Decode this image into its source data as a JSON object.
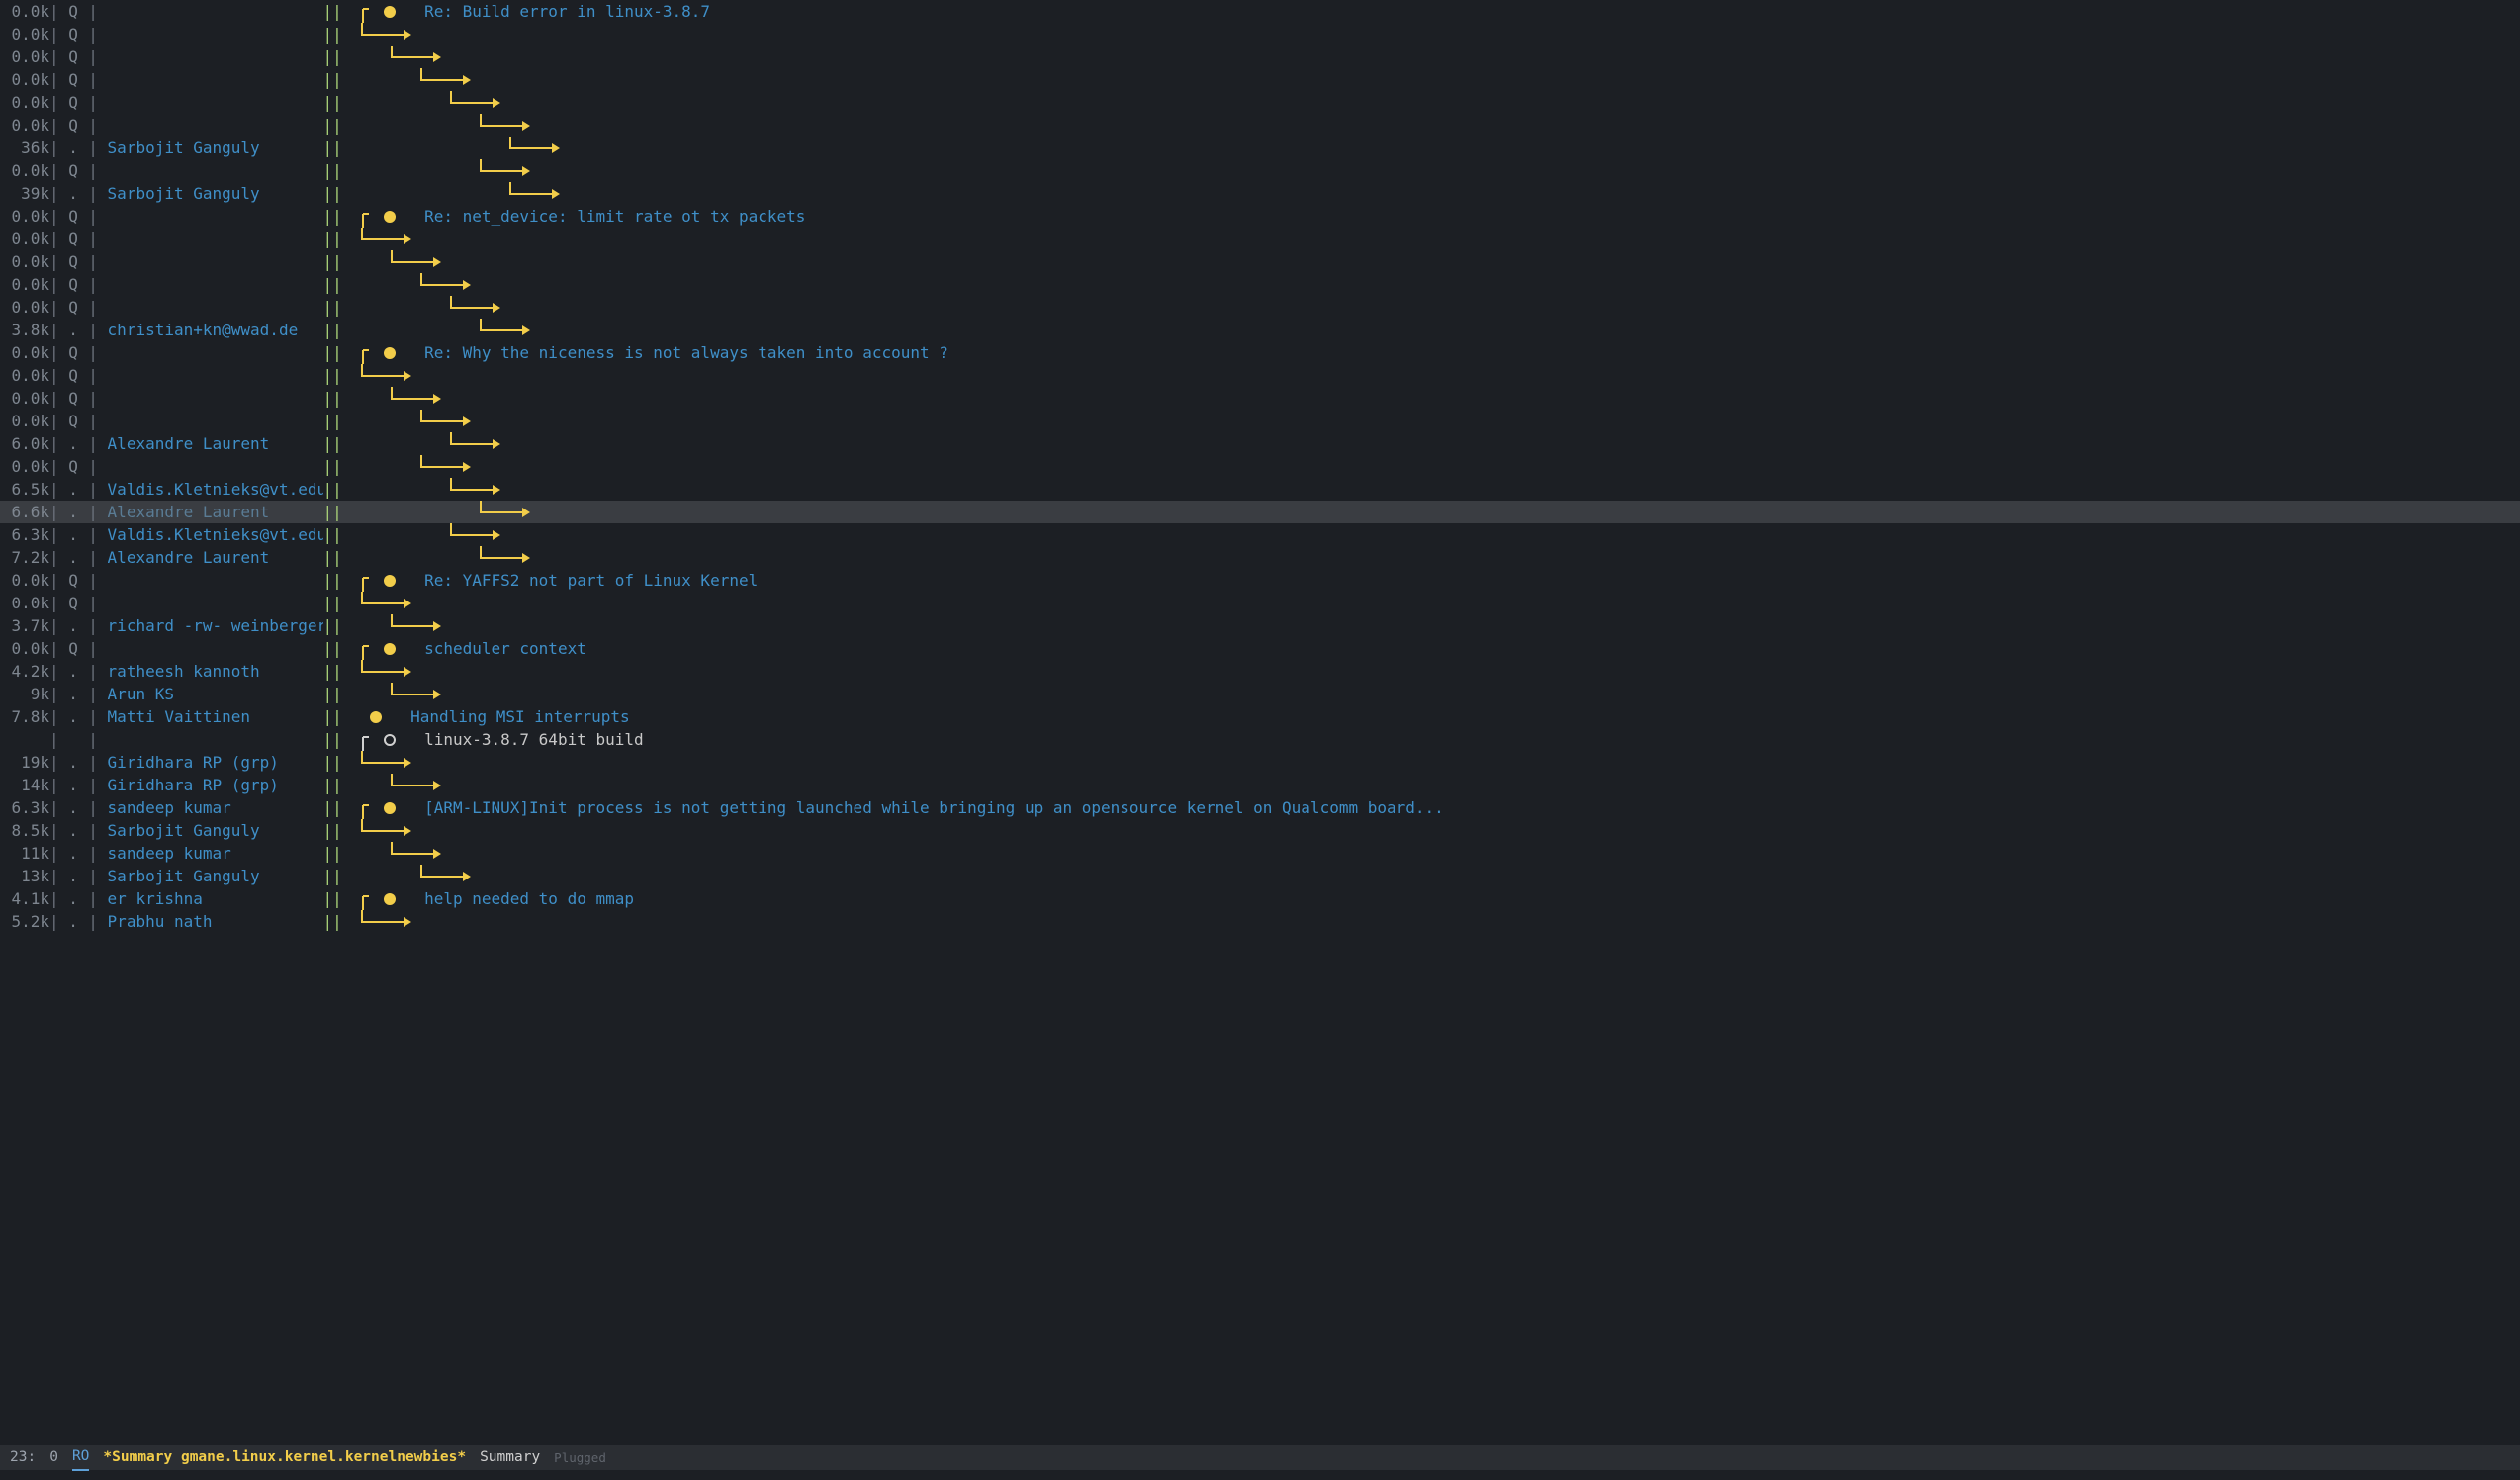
{
  "separator_major": "|",
  "double_bar": "||",
  "modeline": {
    "line": "23:",
    "col": "0",
    "readonly": "RO",
    "buffer": "*Summary gmane.linux.kernel.kernelnewbies*",
    "mode": "Summary",
    "status": "Plugged"
  },
  "rows": [
    {
      "size": "0.0k",
      "mark": "Q",
      "author": "",
      "depth": 0,
      "node": "root",
      "subject": "Re: Build error in linux-3.8.7",
      "highlight": false
    },
    {
      "size": "0.0k",
      "mark": "Q",
      "author": "",
      "depth": 0,
      "node": "child",
      "subject": "",
      "highlight": false
    },
    {
      "size": "0.0k",
      "mark": "Q",
      "author": "",
      "depth": 1,
      "node": "child",
      "subject": "",
      "highlight": false
    },
    {
      "size": "0.0k",
      "mark": "Q",
      "author": "",
      "depth": 2,
      "node": "child",
      "subject": "",
      "highlight": false
    },
    {
      "size": "0.0k",
      "mark": "Q",
      "author": "",
      "depth": 3,
      "node": "child",
      "subject": "",
      "highlight": false
    },
    {
      "size": "0.0k",
      "mark": "Q",
      "author": "",
      "depth": 4,
      "node": "child",
      "subject": "",
      "highlight": false
    },
    {
      "size": "36k",
      "mark": ".",
      "author": "Sarbojit Ganguly",
      "depth": 5,
      "node": "child",
      "subject": "",
      "highlight": false
    },
    {
      "size": "0.0k",
      "mark": "Q",
      "author": "",
      "depth": 4,
      "node": "child",
      "subject": "",
      "highlight": false
    },
    {
      "size": "39k",
      "mark": ".",
      "author": "Sarbojit Ganguly",
      "depth": 5,
      "node": "child",
      "subject": "",
      "highlight": false
    },
    {
      "size": "0.0k",
      "mark": "Q",
      "author": "",
      "depth": 0,
      "node": "root",
      "subject": "Re: net_device: limit rate ot tx packets",
      "highlight": false
    },
    {
      "size": "0.0k",
      "mark": "Q",
      "author": "",
      "depth": 0,
      "node": "child",
      "subject": "",
      "highlight": false
    },
    {
      "size": "0.0k",
      "mark": "Q",
      "author": "",
      "depth": 1,
      "node": "child",
      "subject": "",
      "highlight": false
    },
    {
      "size": "0.0k",
      "mark": "Q",
      "author": "",
      "depth": 2,
      "node": "child",
      "subject": "",
      "highlight": false
    },
    {
      "size": "0.0k",
      "mark": "Q",
      "author": "",
      "depth": 3,
      "node": "child",
      "subject": "",
      "highlight": false
    },
    {
      "size": "3.8k",
      "mark": ".",
      "author": "christian+kn@wwad.de",
      "depth": 4,
      "node": "child",
      "subject": "",
      "highlight": false
    },
    {
      "size": "0.0k",
      "mark": "Q",
      "author": "",
      "depth": 0,
      "node": "root",
      "subject": "Re: Why the niceness is not always taken into account ?",
      "highlight": false
    },
    {
      "size": "0.0k",
      "mark": "Q",
      "author": "",
      "depth": 0,
      "node": "child",
      "subject": "",
      "highlight": false
    },
    {
      "size": "0.0k",
      "mark": "Q",
      "author": "",
      "depth": 1,
      "node": "child",
      "subject": "",
      "highlight": false
    },
    {
      "size": "0.0k",
      "mark": "Q",
      "author": "",
      "depth": 2,
      "node": "child",
      "subject": "",
      "highlight": false
    },
    {
      "size": "6.0k",
      "mark": ".",
      "author": "Alexandre Laurent",
      "depth": 3,
      "node": "child",
      "subject": "",
      "highlight": false
    },
    {
      "size": "0.0k",
      "mark": "Q",
      "author": "",
      "depth": 2,
      "node": "child",
      "subject": "",
      "highlight": false
    },
    {
      "size": "6.5k",
      "mark": ".",
      "author": "Valdis.Kletnieks@vt.edu",
      "depth": 3,
      "node": "child",
      "subject": "",
      "highlight": false
    },
    {
      "size": "6.6k",
      "mark": ".",
      "author": "Alexandre Laurent",
      "depth": 4,
      "node": "child",
      "subject": "",
      "highlight": true
    },
    {
      "size": "6.3k",
      "mark": ".",
      "author": "Valdis.Kletnieks@vt.edu",
      "depth": 3,
      "node": "child",
      "subject": "",
      "highlight": false
    },
    {
      "size": "7.2k",
      "mark": ".",
      "author": "Alexandre Laurent",
      "depth": 4,
      "node": "child",
      "subject": "",
      "highlight": false
    },
    {
      "size": "0.0k",
      "mark": "Q",
      "author": "",
      "depth": 0,
      "node": "root",
      "subject": "Re: YAFFS2 not part of Linux Kernel",
      "highlight": false
    },
    {
      "size": "0.0k",
      "mark": "Q",
      "author": "",
      "depth": 0,
      "node": "child",
      "subject": "",
      "highlight": false
    },
    {
      "size": "3.7k",
      "mark": ".",
      "author": "richard -rw- weinberger",
      "depth": 1,
      "node": "child",
      "subject": "",
      "highlight": false
    },
    {
      "size": "0.0k",
      "mark": "Q",
      "author": "",
      "depth": 0,
      "node": "root",
      "subject": "scheduler context",
      "highlight": false
    },
    {
      "size": "4.2k",
      "mark": ".",
      "author": "ratheesh kannoth",
      "depth": 0,
      "node": "child",
      "subject": "",
      "highlight": false
    },
    {
      "size": "9k",
      "mark": ".",
      "author": "Arun KS",
      "depth": 1,
      "node": "child",
      "subject": "",
      "highlight": false
    },
    {
      "size": "7.8k",
      "mark": ".",
      "author": "Matti Vaittinen",
      "depth": 0,
      "node": "dot",
      "subject": "Handling MSI interrupts",
      "highlight": false
    },
    {
      "size": "",
      "mark": "",
      "author": "",
      "depth": 0,
      "node": "rootopen",
      "subject": "linux-3.8.7 64bit build",
      "highlight": false,
      "plain": true
    },
    {
      "size": "19k",
      "mark": ".",
      "author": "Giridhara RP (grp)",
      "depth": 0,
      "node": "child",
      "subject": "",
      "highlight": false
    },
    {
      "size": "14k",
      "mark": ".",
      "author": "Giridhara RP (grp)",
      "depth": 1,
      "node": "child",
      "subject": "",
      "highlight": false
    },
    {
      "size": "6.3k",
      "mark": ".",
      "author": "sandeep kumar",
      "depth": 0,
      "node": "root",
      "subject": "[ARM-LINUX]Init process is not getting launched while bringing up an opensource kernel on Qualcomm board...",
      "highlight": false
    },
    {
      "size": "8.5k",
      "mark": ".",
      "author": "Sarbojit Ganguly",
      "depth": 0,
      "node": "child",
      "subject": "",
      "highlight": false
    },
    {
      "size": "11k",
      "mark": ".",
      "author": "sandeep kumar",
      "depth": 1,
      "node": "child",
      "subject": "",
      "highlight": false
    },
    {
      "size": "13k",
      "mark": ".",
      "author": "Sarbojit Ganguly",
      "depth": 2,
      "node": "child",
      "subject": "",
      "highlight": false
    },
    {
      "size": "4.1k",
      "mark": ".",
      "author": "er krishna",
      "depth": 0,
      "node": "root",
      "subject": "help needed to do mmap",
      "highlight": false
    },
    {
      "size": "5.2k",
      "mark": ".",
      "author": "Prabhu nath",
      "depth": 0,
      "node": "child",
      "subject": "",
      "highlight": false
    }
  ]
}
